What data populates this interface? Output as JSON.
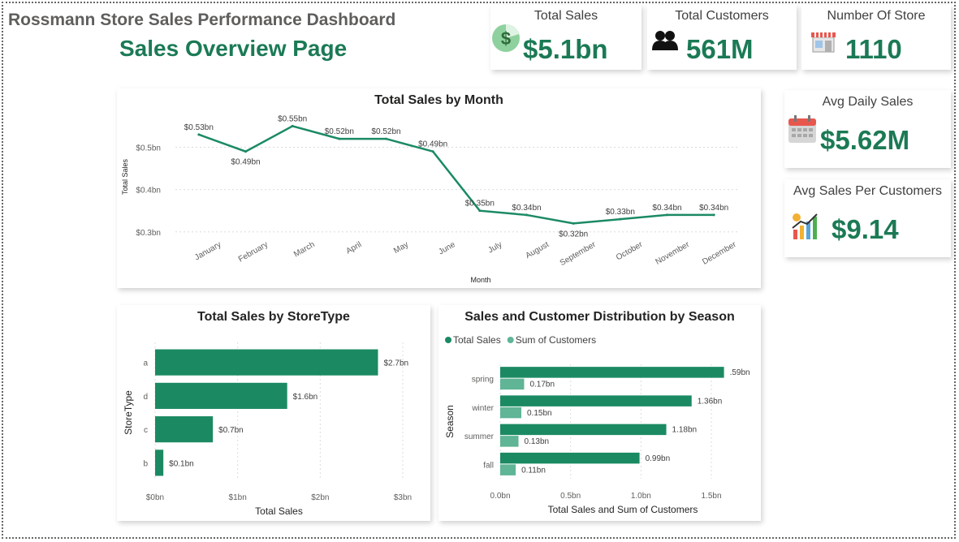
{
  "header": {
    "title": "Rossmann Store Sales Performance Dashboard",
    "subtitle": "Sales Overview Page"
  },
  "kpis": {
    "total_sales": {
      "label": "Total Sales",
      "value": "$5.1bn",
      "icon": "dollar-icon"
    },
    "total_customers": {
      "label": "Total Customers",
      "value": "561M",
      "icon": "people-icon"
    },
    "number_of_store": {
      "label": "Number Of Store",
      "value": "1110",
      "icon": "store-icon"
    },
    "avg_daily_sales": {
      "label": "Avg Daily Sales",
      "value": "$5.62M",
      "icon": "calendar-icon"
    },
    "avg_sales_per_customer": {
      "label": "Avg Sales Per Customers",
      "value": "$9.14",
      "icon": "bar-chart-growth-icon"
    }
  },
  "colors": {
    "primary": "#1b8a63",
    "secondary": "#5fb596",
    "value_text": "#1b7a55"
  },
  "chart_data": [
    {
      "type": "line",
      "title": "Total Sales by Month",
      "xlabel": "Month",
      "ylabel": "Total Sales",
      "categories": [
        "January",
        "February",
        "March",
        "April",
        "May",
        "June",
        "July",
        "August",
        "September",
        "October",
        "November",
        "December"
      ],
      "values": [
        0.53,
        0.49,
        0.55,
        0.52,
        0.52,
        0.49,
        0.35,
        0.34,
        0.32,
        0.33,
        0.34,
        0.34
      ],
      "data_labels": [
        "$0.53bn",
        "$0.49bn",
        "$0.55bn",
        "$0.52bn",
        "$0.52bn",
        "$0.49bn",
        "$0.35bn",
        "$0.34bn",
        "$0.32bn",
        "$0.33bn",
        "$0.34bn",
        "$0.34bn"
      ],
      "yticks": [
        0.3,
        0.4,
        0.5
      ],
      "ytick_labels": [
        "$0.3bn",
        "$0.4bn",
        "$0.5bn"
      ],
      "ylim": [
        0.29,
        0.57
      ],
      "grid": true
    },
    {
      "type": "bar",
      "orientation": "horizontal",
      "title": "Total Sales by StoreType",
      "xlabel": "Total Sales",
      "ylabel": "StoreType",
      "categories": [
        "a",
        "d",
        "c",
        "b"
      ],
      "values": [
        2.7,
        1.6,
        0.7,
        0.1
      ],
      "data_labels": [
        "$2.7bn",
        "$1.6bn",
        "$0.7bn",
        "$0.1bn"
      ],
      "xticks": [
        0,
        1,
        2,
        3
      ],
      "xtick_labels": [
        "$0bn",
        "$1bn",
        "$2bn",
        "$3bn"
      ],
      "xlim": [
        0,
        3
      ],
      "grid": true
    },
    {
      "type": "bar",
      "orientation": "horizontal",
      "title": "Sales and Customer Distribution by Season",
      "xlabel": "Total Sales and Sum of Customers",
      "ylabel": "Season",
      "categories": [
        "spring",
        "winter",
        "summer",
        "fall"
      ],
      "series": [
        {
          "name": "Total Sales",
          "values": [
            1.59,
            1.36,
            1.18,
            0.99
          ],
          "data_labels": [
            ".59bn",
            "1.36bn",
            "1.18bn",
            "0.99bn"
          ]
        },
        {
          "name": "Sum of Customers",
          "values": [
            0.17,
            0.15,
            0.13,
            0.11
          ],
          "data_labels": [
            "0.17bn",
            "0.15bn",
            "0.13bn",
            "0.11bn"
          ]
        }
      ],
      "xticks": [
        0,
        0.5,
        1.0,
        1.5
      ],
      "xtick_labels": [
        "0.0bn",
        "0.5bn",
        "1.0bn",
        "1.5bn"
      ],
      "xlim": [
        0,
        1.65
      ],
      "legend": "top-left",
      "grid": true
    }
  ]
}
